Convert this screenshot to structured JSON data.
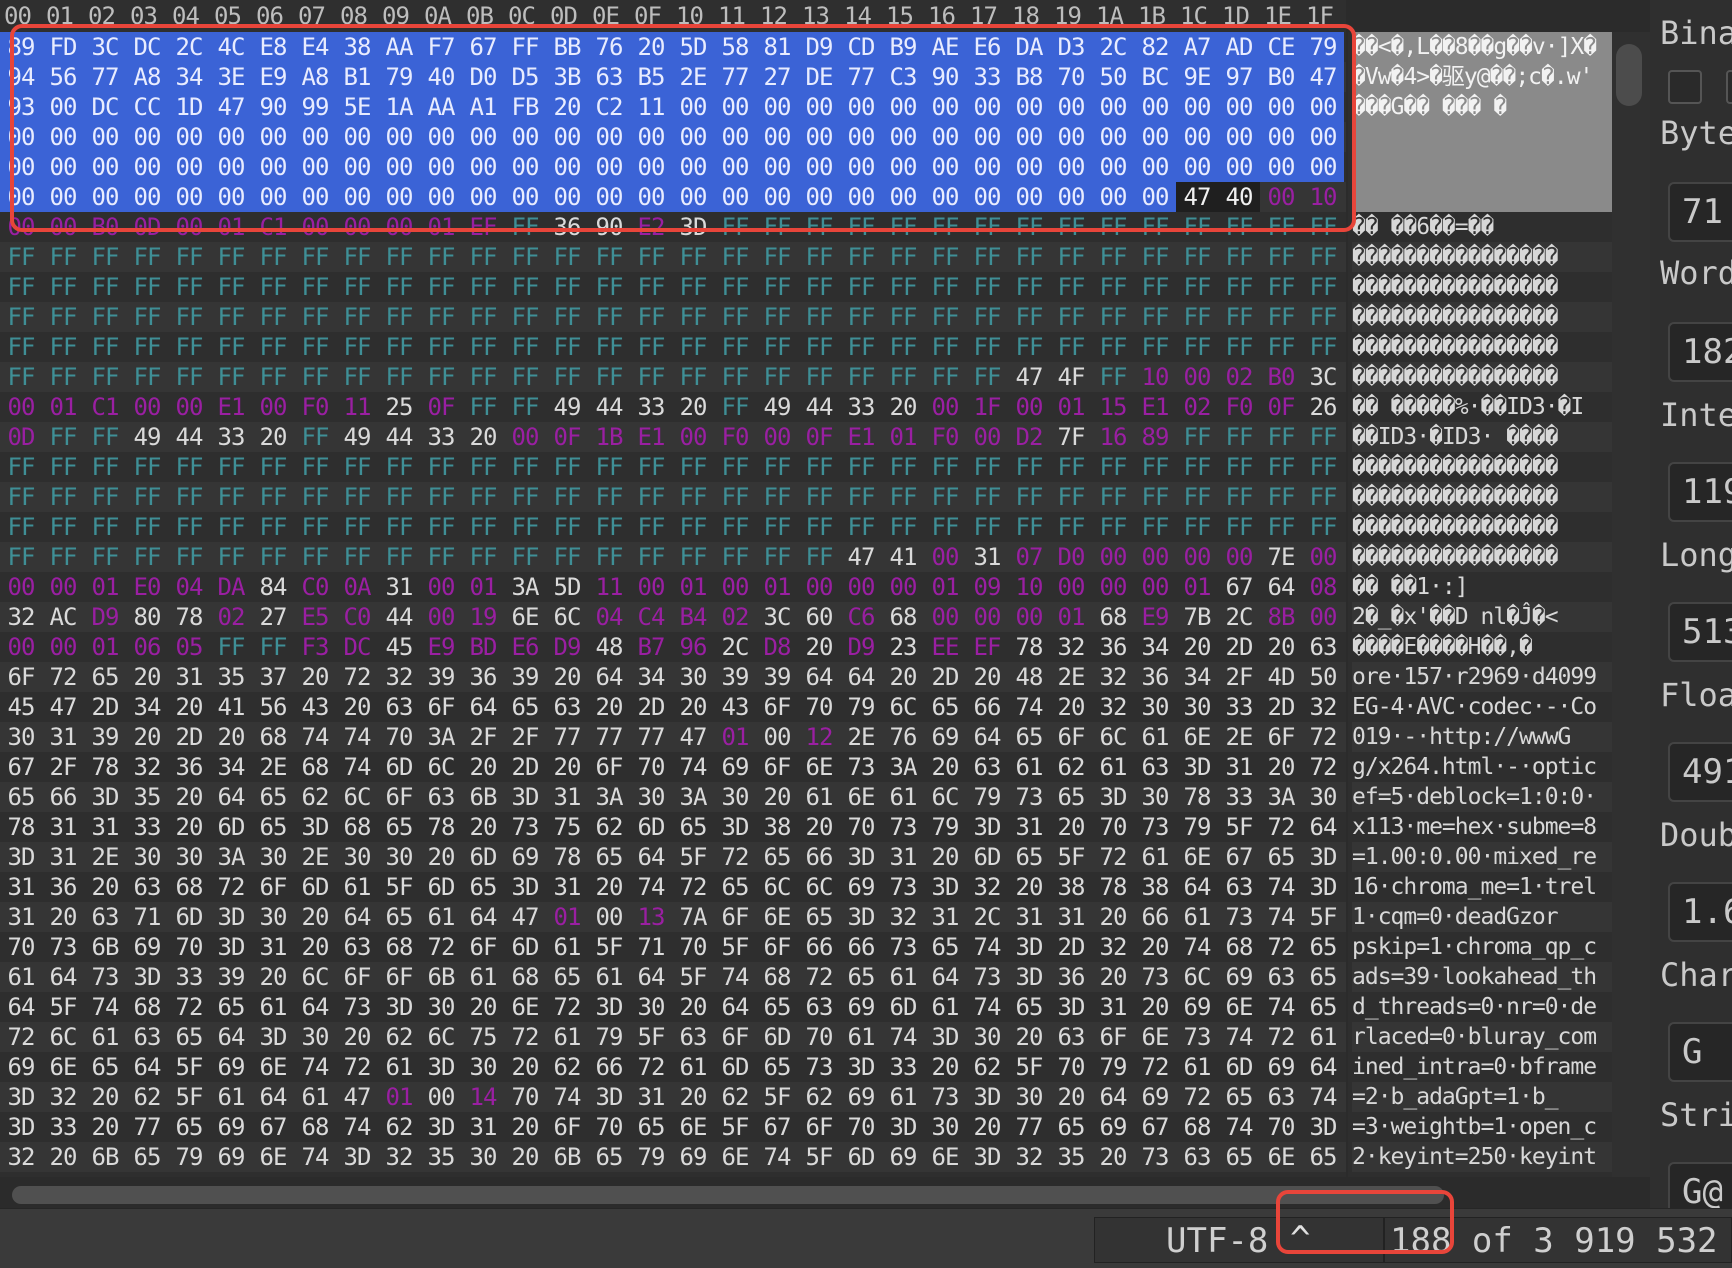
{
  "header": {
    "columns": [
      "00",
      "01",
      "02",
      "03",
      "04",
      "05",
      "06",
      "07",
      "08",
      "09",
      "0A",
      "0B",
      "0C",
      "0D",
      "0E",
      "0F",
      "10",
      "11",
      "12",
      "13",
      "14",
      "15",
      "16",
      "17",
      "18",
      "19",
      "1A",
      "1B",
      "1C",
      "1D",
      "1E",
      "1F"
    ]
  },
  "hex_rows": [
    "89 FD 3C DC 2C 4C E8 E4 38 AA F7 67 FF BB 76 20 5D 58 81 D9 CD B9 AE E6 DA D3 2C 82 A7 AD CE 79",
    "94 56 77 A8 34 3E E9 A8 B1 79 40 D0 D5 3B 63 B5 2E 77 27 DE 77 C3 90 33 B8 70 50 BC 9E 97 B0 47",
    "93 00 DC CC 1D 47 90 99 5E 1A AA A1 FB 20 C2 11 00 00 00 00 00 00 00 00 00 00 00 00 00 00 00 00",
    "00 00 00 00 00 00 00 00 00 00 00 00 00 00 00 00 00 00 00 00 00 00 00 00 00 00 00 00 00 00 00 00",
    "00 00 00 00 00 00 00 00 00 00 00 00 00 00 00 00 00 00 00 00 00 00 00 00 00 00 00 00 00 00 00 00",
    "00 00 00 00 00 00 00 00 00 00 00 00 00 00 00 00 00 00 00 00 00 00 00 00 00 00 00 00 47 40 00 10",
    "00 00 B0 0D 00 01 C1 00 00 00 01 EF FF 36 90 E2 3D FF FF FF FF FF FF FF FF FF FF FF FF FF FF FF",
    "FF FF FF FF FF FF FF FF FF FF FF FF FF FF FF FF FF FF FF FF FF FF FF FF FF FF FF FF FF FF FF FF",
    "FF FF FF FF FF FF FF FF FF FF FF FF FF FF FF FF FF FF FF FF FF FF FF FF FF FF FF FF FF FF FF FF",
    "FF FF FF FF FF FF FF FF FF FF FF FF FF FF FF FF FF FF FF FF FF FF FF FF FF FF FF FF FF FF FF FF",
    "FF FF FF FF FF FF FF FF FF FF FF FF FF FF FF FF FF FF FF FF FF FF FF FF FF FF FF FF FF FF FF FF",
    "FF FF FF FF FF FF FF FF FF FF FF FF FF FF FF FF FF FF FF FF FF FF FF FF 47 4F FF 10 00 02 B0 3C",
    "00 01 C1 00 00 E1 00 F0 11 25 0F FF FF 49 44 33 20 FF 49 44 33 20 00 1F 00 01 15 E1 02 F0 0F 26",
    "0D FF FF 49 44 33 20 FF 49 44 33 20 00 0F 1B E1 00 F0 00 0F E1 01 F0 00 D2 7F 16 89 FF FF FF FF",
    "FF FF FF FF FF FF FF FF FF FF FF FF FF FF FF FF FF FF FF FF FF FF FF FF FF FF FF FF FF FF FF FF",
    "FF FF FF FF FF FF FF FF FF FF FF FF FF FF FF FF FF FF FF FF FF FF FF FF FF FF FF FF FF FF FF FF",
    "FF FF FF FF FF FF FF FF FF FF FF FF FF FF FF FF FF FF FF FF FF FF FF FF FF FF FF FF FF FF FF FF",
    "FF FF FF FF FF FF FF FF FF FF FF FF FF FF FF FF FF FF FF FF 47 41 00 31 07 D0 00 00 00 00 7E 00",
    "00 00 01 E0 04 DA 84 C0 0A 31 00 01 3A 5D 11 00 01 00 01 00 00 00 01 09 10 00 00 00 01 67 64 08",
    "32 AC D9 80 78 02 27 E5 C0 44 00 19 6E 6C 04 C4 B4 02 3C 60 C6 68 00 00 00 01 68 E9 7B 2C 8B 00",
    "00 00 01 06 05 FF FF F3 DC 45 E9 BD E6 D9 48 B7 96 2C D8 20 D9 23 EE EF 78 32 36 34 20 2D 20 63",
    "6F 72 65 20 31 35 37 20 72 32 39 36 39 20 64 34 30 39 39 64 64 20 2D 20 48 2E 32 36 34 2F 4D 50",
    "45 47 2D 34 20 41 56 43 20 63 6F 64 65 63 20 2D 20 43 6F 70 79 6C 65 66 74 20 32 30 30 33 2D 32",
    "30 31 39 20 2D 20 68 74 74 70 3A 2F 2F 77 77 77 47 01 00 12 2E 76 69 64 65 6F 6C 61 6E 2E 6F 72",
    "67 2F 78 32 36 34 2E 68 74 6D 6C 20 2D 20 6F 70 74 69 6F 6E 73 3A 20 63 61 62 61 63 3D 31 20 72",
    "65 66 3D 35 20 64 65 62 6C 6F 63 6B 3D 31 3A 30 3A 30 20 61 6E 61 6C 79 73 65 3D 30 78 33 3A 30",
    "78 31 31 33 20 6D 65 3D 68 65 78 20 73 75 62 6D 65 3D 38 20 70 73 79 3D 31 20 70 73 79 5F 72 64",
    "3D 31 2E 30 30 3A 30 2E 30 30 20 6D 69 78 65 64 5F 72 65 66 3D 31 20 6D 65 5F 72 61 6E 67 65 3D",
    "31 36 20 63 68 72 6F 6D 61 5F 6D 65 3D 31 20 74 72 65 6C 6C 69 73 3D 32 20 38 78 38 64 63 74 3D",
    "31 20 63 71 6D 3D 30 20 64 65 61 64 47 01 00 13 7A 6F 6E 65 3D 32 31 2C 31 31 20 66 61 73 74 5F",
    "70 73 6B 69 70 3D 31 20 63 68 72 6F 6D 61 5F 71 70 5F 6F 66 66 73 65 74 3D 2D 32 20 74 68 72 65",
    "61 64 73 3D 33 39 20 6C 6F 6F 6B 61 68 65 61 64 5F 74 68 72 65 61 64 73 3D 36 20 73 6C 69 63 65",
    "64 5F 74 68 72 65 61 64 73 3D 30 20 6E 72 3D 30 20 64 65 63 69 6D 61 74 65 3D 31 20 69 6E 74 65",
    "72 6C 61 63 65 64 3D 30 20 62 6C 75 72 61 79 5F 63 6F 6D 70 61 74 3D 30 20 63 6F 6E 73 74 72 61",
    "69 6E 65 64 5F 69 6E 74 72 61 3D 30 20 62 66 72 61 6D 65 73 3D 33 20 62 5F 70 79 72 61 6D 69 64",
    "3D 32 20 62 5F 61 64 61 47 01 00 14 70 74 3D 31 20 62 5F 62 69 61 73 3D 30 20 64 69 72 65 63 74",
    "3D 33 20 77 65 69 67 68 74 62 3D 31 20 6F 70 65 6E 5F 67 6F 70 3D 30 20 77 65 69 67 68 74 70 3D",
    "32 20 6B 65 79 69 6E 74 3D 32 35 30 20 6B 65 79 69 6E 74 5F 6D 69 6E 3D 32 35 20 73 63 65 6E 65"
  ],
  "text_rows": [
    "��<�,L��8��g��v·]X�",
    "�Vw�4>�驱y@��;c�.w'",
    "���G�� ��� �",
    "",
    "",
    "",
    "�� ��6��=��",
    "����������������",
    "����������������",
    "����������������",
    "����������������",
    "����������������",
    "�� �����%·��ID3·�I",
    "��ID3·�ID3· ����",
    "����������������",
    "����������������",
    "����������������",
    "����������������",
    "�� ��1·:]",
    "2�_�x'��D nl�Ĵ�<",
    "����E����H��,�",
    "ore·157·r2969·d4099",
    "EG-4·AVC·codec·-·Co",
    "019·-·http://wwwG",
    "g/x264.html·-·optic",
    "ef=5·deblock=1:0:0·",
    "x113·me=hex·subme=8",
    "=1.00:0.00·mixed_re",
    "16·chroma_me=1·trel",
    "1·cqm=0·deadGzor",
    "pskip=1·chroma_qp_c",
    "ads=39·lookahead_th",
    "d_threads=0·nr=0·de",
    "rlaced=0·bluray_com",
    "ined_intra=0·bframe",
    "=2·b_adaGpt=1·b_",
    "=3·weightb=1·open_c",
    "2·keyint=250·keyint"
  ],
  "inspector": {
    "binary_label": "Bina",
    "byte_label": "Byte",
    "byte_value": "71",
    "word_label": "Word",
    "word_value": "182",
    "integer_label": "Inte",
    "integer_value": "119",
    "long_label": "Long",
    "long_value": "513",
    "float_label": "Floa",
    "float_value": "491",
    "double_label": "Doub",
    "double_value": "1.6",
    "char_label": "Char",
    "char_value": "G",
    "string_label": "Stri",
    "string_value": "G@"
  },
  "status_bar": {
    "encoding": "UTF-8",
    "caret": "^",
    "offset": "188 of 3 919 532"
  },
  "colors": {
    "selection": "#3b63d6",
    "ff_byte": "#3f8f96",
    "ctrl_byte": "#9a1fa2",
    "annotation": "#e8453a"
  }
}
